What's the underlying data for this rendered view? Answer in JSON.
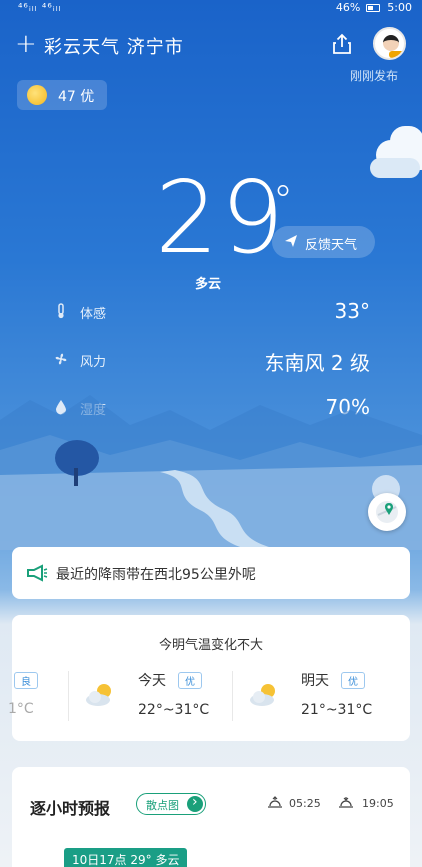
{
  "status_bar": {
    "signal_text": "⁴⁶ᵢₗₗ ⁴⁶ᵢₗₗ",
    "battery": "46%",
    "time": "5:00"
  },
  "header": {
    "title": "彩云天气  济宁市",
    "published": "刚刚发布"
  },
  "aqi": {
    "label": "47 优"
  },
  "current": {
    "temperature": "29",
    "degree": "°",
    "condition": "多云",
    "feedback_label": "反馈天气",
    "details": [
      {
        "icon": "thermometer-icon",
        "label": "体感",
        "value": "33°"
      },
      {
        "icon": "fan-icon",
        "label": "风力",
        "value": "东南风 2 级"
      },
      {
        "icon": "droplet-icon",
        "label": "湿度",
        "value": "70%"
      }
    ]
  },
  "notice": {
    "text": "最近的降雨带在西北95公里外呢"
  },
  "forecast": {
    "headline": "今明气温变化不大",
    "days": [
      {
        "day": "",
        "badge": "良",
        "range": "1°C"
      },
      {
        "day": "今天",
        "badge": "优",
        "range": "22°~31°C"
      },
      {
        "day": "明天",
        "badge": "优",
        "range": "21°~31°C"
      }
    ]
  },
  "hourly": {
    "title": "逐小时预报",
    "scatter_label": "散点图",
    "sunrise": "05:25",
    "sunset": "19:05",
    "current_tag": "10日17点 29° 多云"
  },
  "colors": {
    "accent": "#1aa07a",
    "sky": "#2a78d4",
    "badge_blue": "#3b8ed8"
  }
}
